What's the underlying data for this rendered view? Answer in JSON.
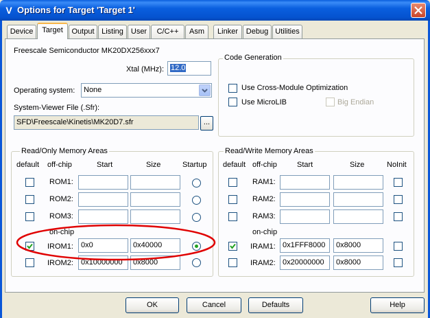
{
  "window": {
    "title": "Options for Target 'Target 1'",
    "icon": "keil-uvision-icon"
  },
  "tabs": [
    "Device",
    "Target",
    "Output",
    "Listing",
    "User",
    "C/C++",
    "Asm",
    "Linker",
    "Debug",
    "Utilities"
  ],
  "active_tab": "Target",
  "device_name": "Freescale Semiconductor MK20DX256xxx7",
  "xtal": {
    "label": "Xtal (MHz):",
    "value": "12.0"
  },
  "operating_system": {
    "label": "Operating system:",
    "value": "None"
  },
  "system_viewer": {
    "label": "System-Viewer File (.Sfr):",
    "value": "SFD\\Freescale\\Kinetis\\MK20D7.sfr",
    "browse_label": "..."
  },
  "code_generation": {
    "title": "Code Generation",
    "cross_module": {
      "label": "Use Cross-Module Optimization",
      "checked": false
    },
    "microlib": {
      "label": "Use MicroLIB",
      "checked": false
    },
    "big_endian": {
      "label": "Big Endian",
      "checked": false,
      "enabled": false
    }
  },
  "rom_areas": {
    "title": "Read/Only Memory Areas",
    "headers": {
      "default": "default",
      "offchip": "off-chip",
      "start": "Start",
      "size": "Size",
      "startup": "Startup"
    },
    "onchip_label": "on-chip",
    "rows": [
      {
        "name": "ROM1:",
        "default": false,
        "start": "",
        "size": "",
        "startup": false
      },
      {
        "name": "ROM2:",
        "default": false,
        "start": "",
        "size": "",
        "startup": false
      },
      {
        "name": "ROM3:",
        "default": false,
        "start": "",
        "size": "",
        "startup": false
      },
      {
        "name": "IROM1:",
        "default": true,
        "start": "0x0",
        "size": "0x40000",
        "startup": true
      },
      {
        "name": "IROM2:",
        "default": false,
        "start": "0x10000000",
        "size": "0x8000",
        "startup": false
      }
    ]
  },
  "ram_areas": {
    "title": "Read/Write Memory Areas",
    "headers": {
      "default": "default",
      "offchip": "off-chip",
      "start": "Start",
      "size": "Size",
      "noinit": "NoInit"
    },
    "onchip_label": "on-chip",
    "rows": [
      {
        "name": "RAM1:",
        "default": false,
        "start": "",
        "size": "",
        "noinit": false
      },
      {
        "name": "RAM2:",
        "default": false,
        "start": "",
        "size": "",
        "noinit": false
      },
      {
        "name": "RAM3:",
        "default": false,
        "start": "",
        "size": "",
        "noinit": false
      },
      {
        "name": "IRAM1:",
        "default": true,
        "start": "0x1FFF8000",
        "size": "0x8000",
        "noinit": false
      },
      {
        "name": "IRAM2:",
        "default": false,
        "start": "0x20000000",
        "size": "0x8000",
        "noinit": false
      }
    ]
  },
  "buttons": {
    "ok": "OK",
    "cancel": "Cancel",
    "defaults": "Defaults",
    "help": "Help"
  },
  "colors": {
    "titlebar": "#0a5fdf",
    "panel": "#fcfcfe",
    "dialog": "#ece9d8",
    "highlight_ellipse": "#e00000",
    "selection": "#316ac5"
  }
}
